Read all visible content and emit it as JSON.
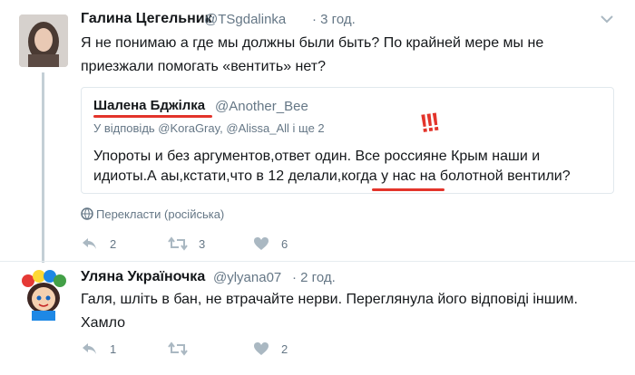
{
  "tweet1": {
    "author": "Галина Цегельник",
    "handle": "@TSgdalinka",
    "time": "· 3 год.",
    "text_line1": "Я не понимаю а где мы должны были быть?  По крайней мере мы не",
    "text_line2": "приезжали помогать «вентить» нет?",
    "quote": {
      "author": "Шалена Бджілка",
      "handle": "@Another_Bee",
      "reply_to": "У відповідь @KoraGray, @Alissa_All і ще 2",
      "text_line1": "Упороты и без аргументов,ответ один. Все россияне Крым наши и",
      "text_line2": "идиоты.А аы,кстати,что в 12 делали,когда у нас на болотной вентили?"
    },
    "translate": "Перекласти (російська)",
    "replies": "2",
    "retweets": "3",
    "likes": "6"
  },
  "tweet2": {
    "author": "Уляна Україночка",
    "handle": "@ylyana07",
    "time": "· 2 год.",
    "text_line1": "Галя, шліть в бан, не втрачайте нерви. Переглянула його відповіді іншим.",
    "text_line2": "Хамло",
    "replies": "1",
    "retweets": "",
    "likes": "2"
  },
  "annotation": {
    "exclamation": "!!!"
  },
  "colors": {
    "accent_red": "#e3342b",
    "icon_gray": "#aab8c2",
    "text_gray": "#657786"
  }
}
